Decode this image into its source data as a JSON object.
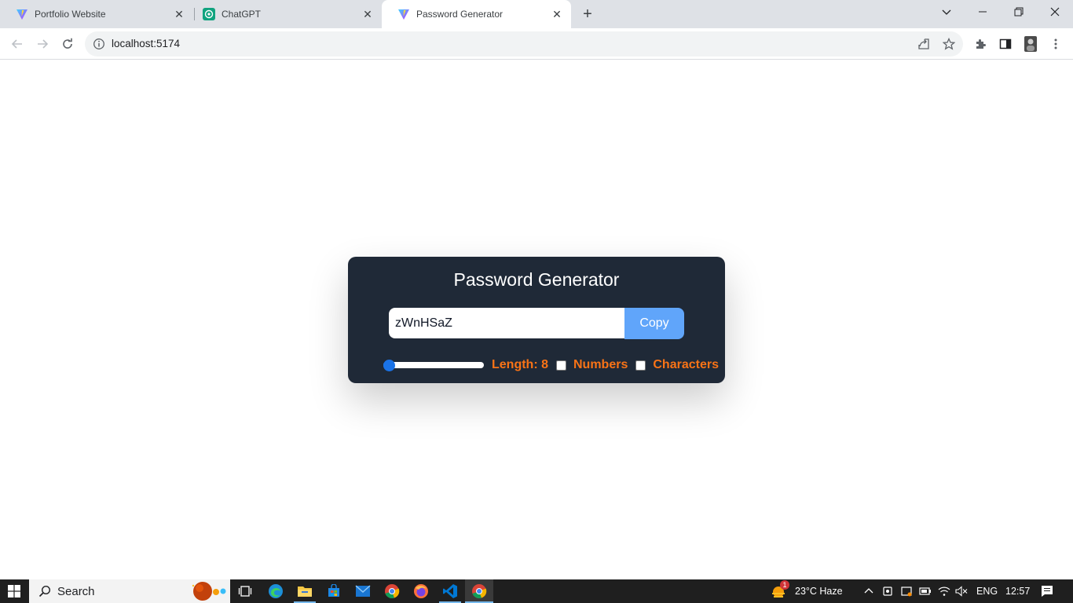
{
  "browser": {
    "tabs": [
      {
        "title": "Portfolio Website",
        "active": false
      },
      {
        "title": "ChatGPT",
        "active": false
      },
      {
        "title": "Password Generator",
        "active": true
      }
    ],
    "url": "localhost:5174"
  },
  "app": {
    "title": "Password Generator",
    "password_value": "zWnHSaZ",
    "copy_label": "Copy",
    "length_label": "Length: 8",
    "length_value": 8,
    "length_min": 6,
    "length_max": 100,
    "numbers_label": "Numbers",
    "numbers_checked": false,
    "characters_label": "Characters",
    "characters_checked": false,
    "colors": {
      "card": "#1f2937",
      "accent": "#f97316",
      "button": "#60a5fa"
    }
  },
  "taskbar": {
    "search_label": "Search",
    "weather": "23°C  Haze",
    "weather_badge": "1",
    "language": "ENG",
    "time": "12:57"
  }
}
